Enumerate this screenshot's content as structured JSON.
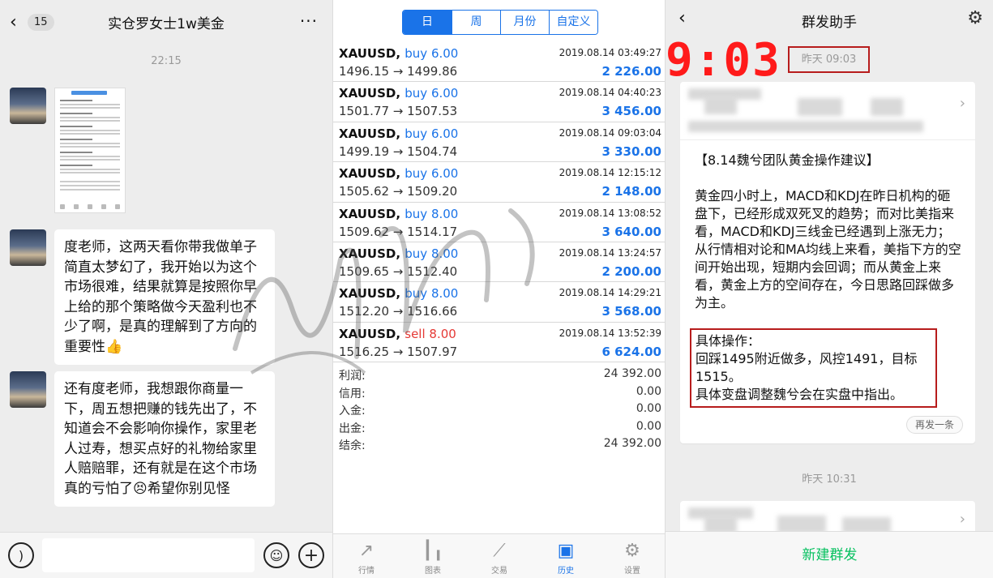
{
  "chat": {
    "back_count": "15",
    "title": "实仓罗女士1w美金",
    "more": "···",
    "timestamp": "22:15",
    "messages": [
      {
        "type": "image",
        "content": "screenshot"
      },
      {
        "type": "text",
        "content": "度老师，这两天看你带我做单子简直太梦幻了，我开始以为这个市场很难，结果就算是按照你早上给的那个策略做今天盈利也不少了啊，是真的理解到了方向的重要性👍"
      },
      {
        "type": "text",
        "content": "还有度老师，我想跟你商量一下，周五想把赚的钱先出了，不知道会不会影响你操作，家里老人过寿，想买点好的礼物给家里人赔赔罪，还有就是在这个市场真的亏怕了😣希望你别见怪"
      }
    ]
  },
  "history": {
    "segments": [
      "日",
      "周",
      "月份",
      "自定义"
    ],
    "active_segment": "日",
    "trades": [
      {
        "symbol": "XAUUSD,",
        "action": "buy",
        "lots": "buy 6.00",
        "price": "1496.15 → 1499.86",
        "time": "2019.08.14 03:49:27",
        "profit": "2 226.00"
      },
      {
        "symbol": "XAUUSD,",
        "action": "buy",
        "lots": "buy 6.00",
        "price": "1501.77 → 1507.53",
        "time": "2019.08.14 04:40:23",
        "profit": "3 456.00"
      },
      {
        "symbol": "XAUUSD,",
        "action": "buy",
        "lots": "buy 6.00",
        "price": "1499.19 → 1504.74",
        "time": "2019.08.14 09:03:04",
        "profit": "3 330.00"
      },
      {
        "symbol": "XAUUSD,",
        "action": "buy",
        "lots": "buy 6.00",
        "price": "1505.62 → 1509.20",
        "time": "2019.08.14 12:15:12",
        "profit": "2 148.00"
      },
      {
        "symbol": "XAUUSD,",
        "action": "buy",
        "lots": "buy 8.00",
        "price": "1509.62 → 1514.17",
        "time": "2019.08.14 13:08:52",
        "profit": "3 640.00"
      },
      {
        "symbol": "XAUUSD,",
        "action": "buy",
        "lots": "buy 8.00",
        "price": "1509.65 → 1512.40",
        "time": "2019.08.14 13:24:57",
        "profit": "2 200.00"
      },
      {
        "symbol": "XAUUSD,",
        "action": "buy",
        "lots": "buy 8.00",
        "price": "1512.20 → 1516.66",
        "time": "2019.08.14 14:29:21",
        "profit": "3 568.00"
      },
      {
        "symbol": "XAUUSD,",
        "action": "sell",
        "lots": "sell 8.00",
        "price": "1516.25 → 1507.97",
        "time": "2019.08.14 13:52:39",
        "profit": "6 624.00"
      }
    ],
    "summary": [
      {
        "label": "利润:",
        "value": "24 392.00"
      },
      {
        "label": "信用:",
        "value": "0.00"
      },
      {
        "label": "入金:",
        "value": "0.00"
      },
      {
        "label": "出金:",
        "value": "0.00"
      },
      {
        "label": "结余:",
        "value": "24 392.00"
      }
    ],
    "tabs": [
      {
        "label": "行情",
        "icon": "chart-up-icon"
      },
      {
        "label": "图表",
        "icon": "candlestick-icon"
      },
      {
        "label": "交易",
        "icon": "trade-icon"
      },
      {
        "label": "历史",
        "icon": "inbox-icon"
      },
      {
        "label": "设置",
        "icon": "gear-icon"
      }
    ],
    "active_tab": "历史",
    "colors": {
      "accent": "#1a73e8",
      "sell": "#e53935"
    }
  },
  "broadcast": {
    "title": "群发助手",
    "overlay_time": "9:03",
    "stamp_time": "昨天 09:03",
    "card_title": "【8.14魏兮团队黄金操作建议】",
    "card_paragraph": "黄金四小时上，MACD和KDJ在昨日机构的砸盘下，已经形成双死叉的趋势；而对比美指来看，MACD和KDJ三线金已经遇到上涨无力；从行情相对论和MA均线上来看，美指下方的空间开始出现，短期内会回调；而从黄金上来看，黄金上方的空间存在，今日思路回踩做多为主。",
    "ops_lines": [
      "具体操作：",
      "回踩1495附近做多，风控1491，目标1515。",
      "具体变盘调整魏兮会在实盘中指出。"
    ],
    "resend": "再发一条",
    "second_time": "昨天 10:31",
    "new_button": "新建群发",
    "colors": {
      "overlay": "#ff1a1a",
      "highlight_box": "#b71c1c",
      "action": "#07c160"
    }
  }
}
